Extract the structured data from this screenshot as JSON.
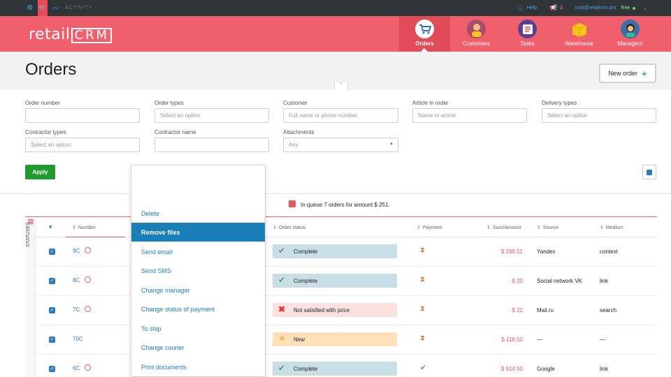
{
  "topbar": {
    "activity": "ACTIVITY",
    "help": "Help",
    "notifications": "3",
    "email": "mail@retailcrm.pro",
    "plan": "free"
  },
  "brand": {
    "logo_left": "retail",
    "logo_right": "CRM"
  },
  "nav": [
    {
      "label": "Orders",
      "icon": "cart-icon"
    },
    {
      "label": "Customers",
      "icon": "customer-icon"
    },
    {
      "label": "Tasks",
      "icon": "tasks-icon"
    },
    {
      "label": "Warehouse",
      "icon": "box-icon"
    },
    {
      "label": "Managers",
      "icon": "manager-icon"
    }
  ],
  "page": {
    "title": "Orders",
    "new_order": "New order"
  },
  "filters": {
    "order_number": {
      "label": "Order number",
      "placeholder": ""
    },
    "order_types": {
      "label": "Order types",
      "placeholder": "Select an option"
    },
    "customer": {
      "label": "Customer",
      "placeholder": "Full name or phone number"
    },
    "article": {
      "label": "Article in order",
      "placeholder": "Name or article"
    },
    "delivery_types": {
      "label": "Delivery types",
      "placeholder": "Select an option"
    },
    "contractor_types": {
      "label": "Contractor types",
      "placeholder": "Select an option"
    },
    "contractor_name": {
      "label": "Contractor name",
      "placeholder": ""
    },
    "attachments": {
      "label": "Attachments",
      "value": "Any"
    },
    "apply": "Apply"
  },
  "queue": {
    "text": "In queue 7 orders for amount $ 251."
  },
  "table": {
    "statuses_label": "STATUSES",
    "headers": {
      "number": "Number",
      "order_status": "Order status",
      "payment": "Payment",
      "sum": "Sum/Amount",
      "source": "Source",
      "medium": "Medium"
    },
    "rows": [
      {
        "number": "9C",
        "status": "Complete",
        "sum": "$ 288,51",
        "source": "Yandex",
        "medium": "context"
      },
      {
        "number": "8C",
        "status": "Complete",
        "sum": "$ 20",
        "source": "Social network VK",
        "medium": "link"
      },
      {
        "number": "7C",
        "status": "Not satisfied with price",
        "sum": "$ 22",
        "source": "Mail.ru",
        "medium": "search"
      },
      {
        "number": "70C",
        "status": "New",
        "sum": "$ 118,50",
        "source": "—",
        "medium": "—"
      },
      {
        "number": "6C",
        "status": "Complete",
        "sum": "$ 914,50",
        "source": "Google",
        "medium": "link"
      }
    ]
  },
  "bulk_menu": {
    "items": [
      "Delete",
      "Remove files",
      "Send email",
      "Send SMS",
      "Change manager",
      "Change status of payment",
      "To ship",
      "Change courier",
      "Print documents"
    ]
  },
  "colors": {
    "brand": "#f0606c",
    "link": "#2d7bbf",
    "selected_menu": "#1a7fb7",
    "apply": "#1f9a2c"
  }
}
